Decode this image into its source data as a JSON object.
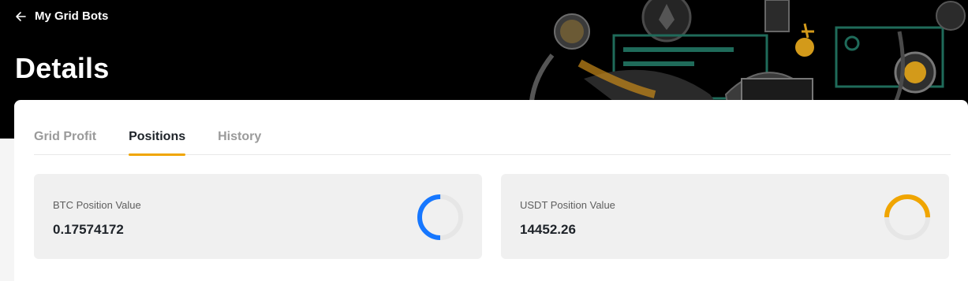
{
  "header": {
    "back_label": "My Grid Bots",
    "title": "Details"
  },
  "tabs": [
    {
      "label": "Grid Profit",
      "active": false
    },
    {
      "label": "Positions",
      "active": true
    },
    {
      "label": "History",
      "active": false
    }
  ],
  "cards": [
    {
      "label": "BTC Position Value",
      "value": "0.17574172",
      "ring_fraction": 0.5,
      "ring_color": "#1677ff"
    },
    {
      "label": "USDT Position Value",
      "value": "14452.26",
      "ring_fraction": 0.5,
      "ring_color": "#f0a500"
    }
  ],
  "colors": {
    "accent": "#f0a500",
    "btc_ring": "#1677ff",
    "usdt_ring": "#f0a500"
  },
  "icons": {
    "back": "arrow-left-icon"
  }
}
